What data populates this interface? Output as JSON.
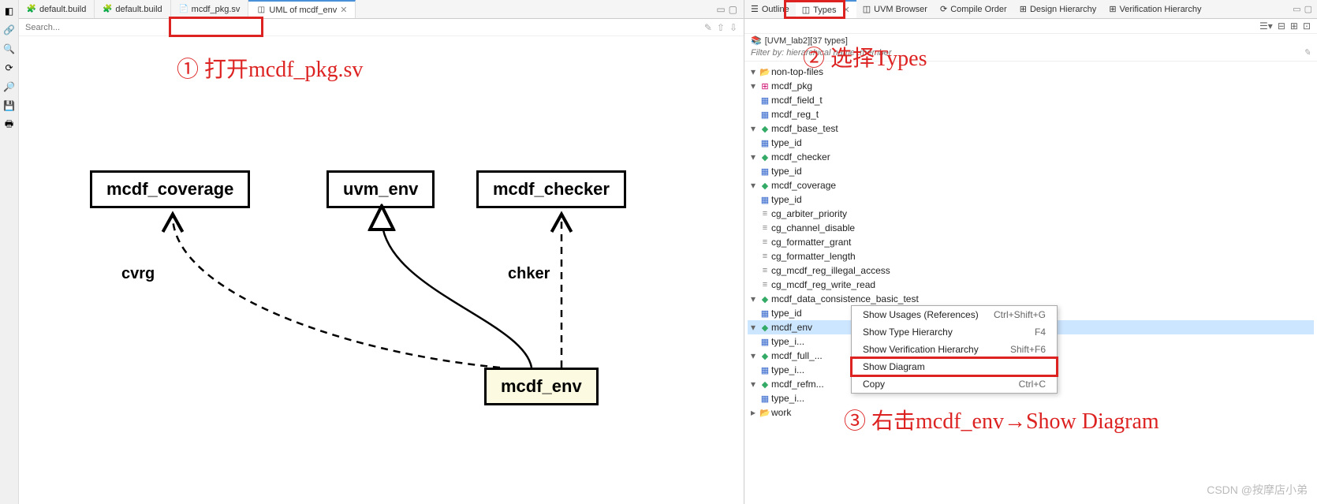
{
  "tabs": {
    "t1": "default.build",
    "t2": "default.build",
    "t3": "mcdf_pkg.sv",
    "t4": "UML of mcdf_env"
  },
  "search": {
    "placeholder": "Search..."
  },
  "uml": {
    "coverage": "mcdf_coverage",
    "uvm_env": "uvm_env",
    "checker": "mcdf_checker",
    "env": "mcdf_env",
    "cvrg": "cvrg",
    "chker": "chker"
  },
  "annot": {
    "a1": "① 打开mcdf_pkg.sv",
    "a2": "② 选择Types",
    "a3": "③ 右击mcdf_env→Show Diagram"
  },
  "rtabs": {
    "outline": "Outline",
    "types": "Types",
    "uvm": "UVM Browser",
    "compile": "Compile Order",
    "design": "Design Hierarchy",
    "verif": "Verification Hierarchy"
  },
  "path": "[UVM_lab2][37 types]",
  "filter": {
    "placeholder": "Filter by: hierarchical name .member"
  },
  "tree": {
    "nontop": "non-top-files",
    "pkg": "mcdf_pkg",
    "field_t": "mcdf_field_t",
    "reg_t": "mcdf_reg_t",
    "base_test": "mcdf_base_test",
    "type_id": "type_id",
    "checker": "mcdf_checker",
    "coverage": "mcdf_coverage",
    "cg_ap": "cg_arbiter_priority",
    "cg_cd": "cg_channel_disable",
    "cg_fg": "cg_formatter_grant",
    "cg_fl": "cg_formatter_length",
    "cg_il": "cg_mcdf_reg_illegal_access",
    "cg_wr": "cg_mcdf_reg_write_read",
    "data_test": "mcdf_data_consistence_basic_test",
    "env": "mcdf_env",
    "type_i": "type_i...",
    "full": "mcdf_full_...",
    "refm": "mcdf_refm...",
    "work": "work"
  },
  "ctx": {
    "usages": "Show Usages (References)",
    "usages_k": "Ctrl+Shift+G",
    "th": "Show Type Hierarchy",
    "th_k": "F4",
    "vh": "Show Verification Hierarchy",
    "vh_k": "Shift+F6",
    "sd": "Show Diagram",
    "cp": "Copy",
    "cp_k": "Ctrl+C"
  },
  "watermark": "CSDN @按摩店小弟"
}
